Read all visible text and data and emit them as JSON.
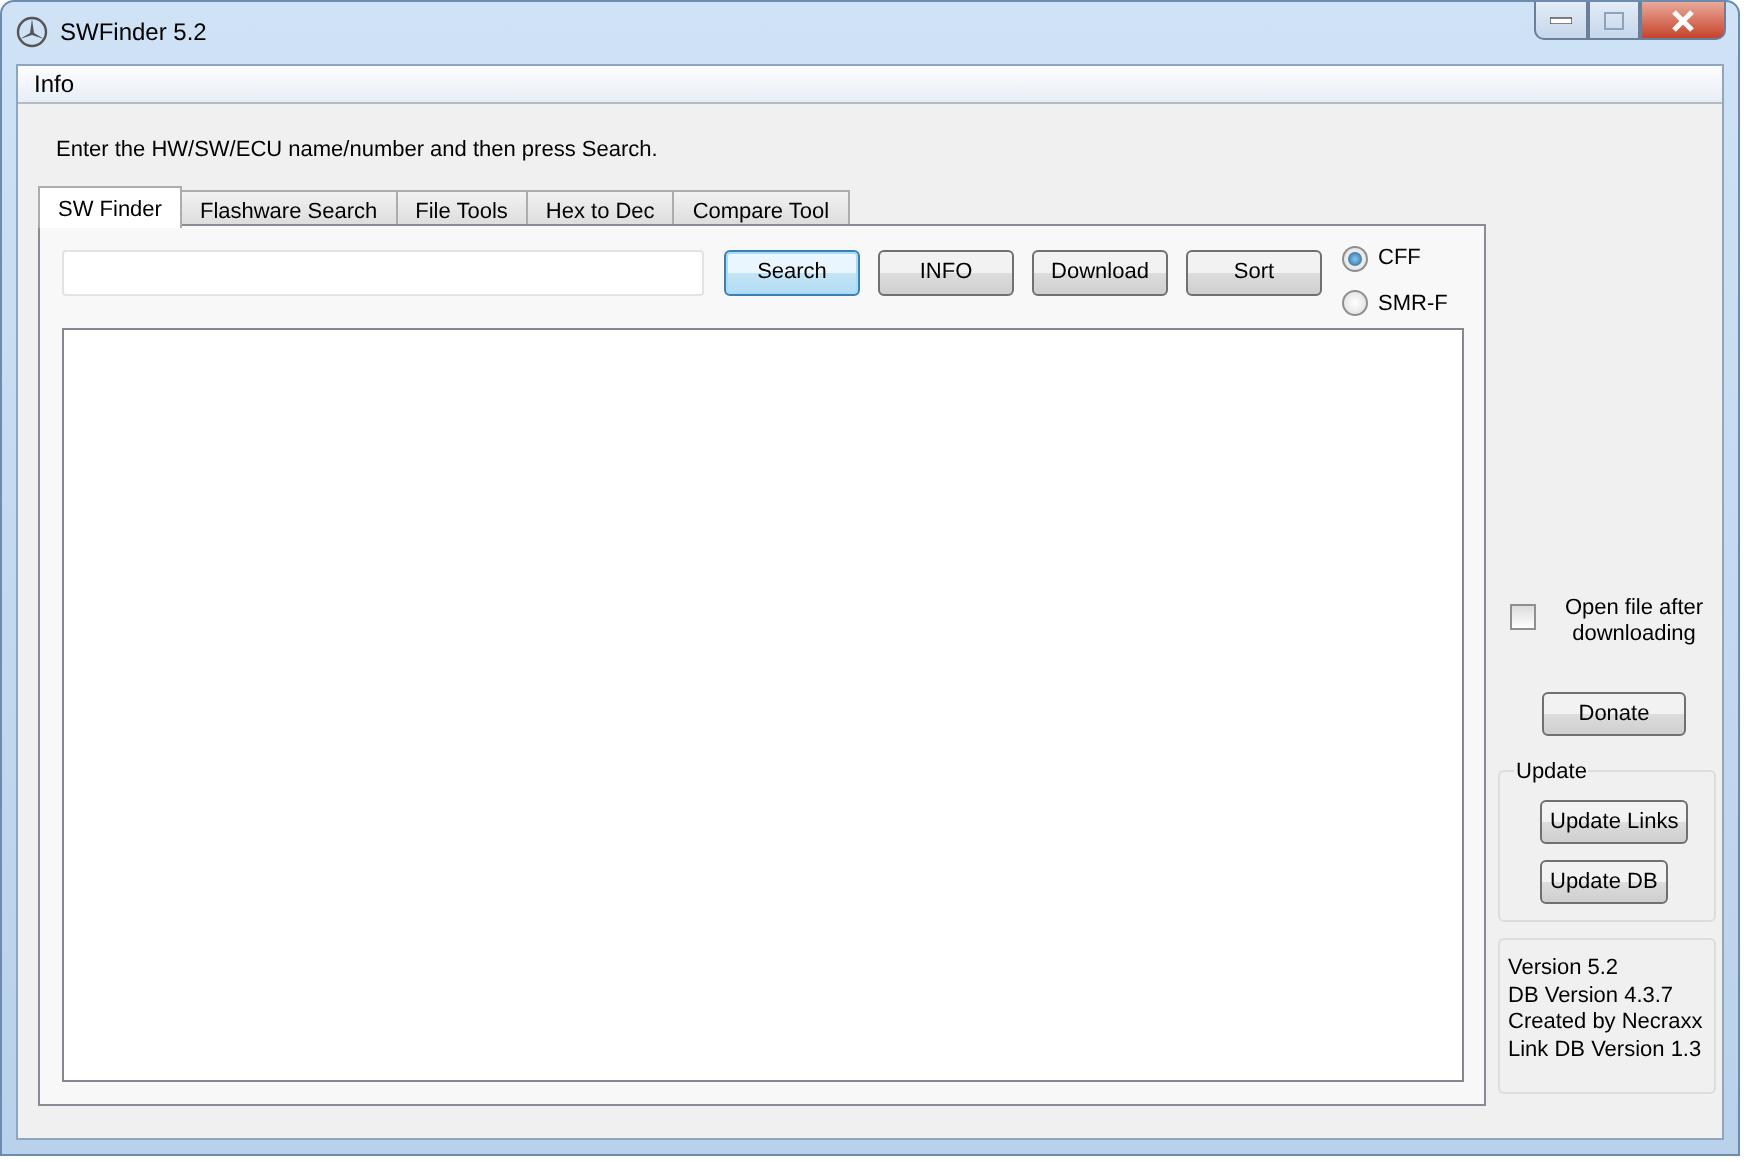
{
  "window": {
    "title": "SWFinder 5.2"
  },
  "menu": [
    {
      "label": "Info"
    }
  ],
  "instruction": "Enter the HW/SW/ECU name/number and then press Search.",
  "tabs": [
    {
      "label": "SW Finder",
      "selected": true
    },
    {
      "label": "Flashware Search",
      "selected": false
    },
    {
      "label": "File Tools",
      "selected": false
    },
    {
      "label": "Hex to Dec",
      "selected": false
    },
    {
      "label": "Compare Tool",
      "selected": false
    }
  ],
  "actions": [
    {
      "label": "Search",
      "focused": true
    },
    {
      "label": "INFO",
      "focused": false
    },
    {
      "label": "Download",
      "focused": false
    },
    {
      "label": "Sort",
      "focused": false
    }
  ],
  "format_options": [
    {
      "label": "CFF",
      "selected": true
    },
    {
      "label": "SMR-F",
      "selected": false
    }
  ],
  "open_after_download": {
    "label": "Open file after downloading",
    "checked": false
  },
  "donate_button": "Donate",
  "update_group": {
    "title": "Update",
    "buttons": [
      "Update Links",
      "Update DB"
    ]
  },
  "info_lines": [
    "Version 5.2",
    "DB Version 4.3.7",
    "Created by Necraxx",
    "Link DB Version 1.3"
  ]
}
